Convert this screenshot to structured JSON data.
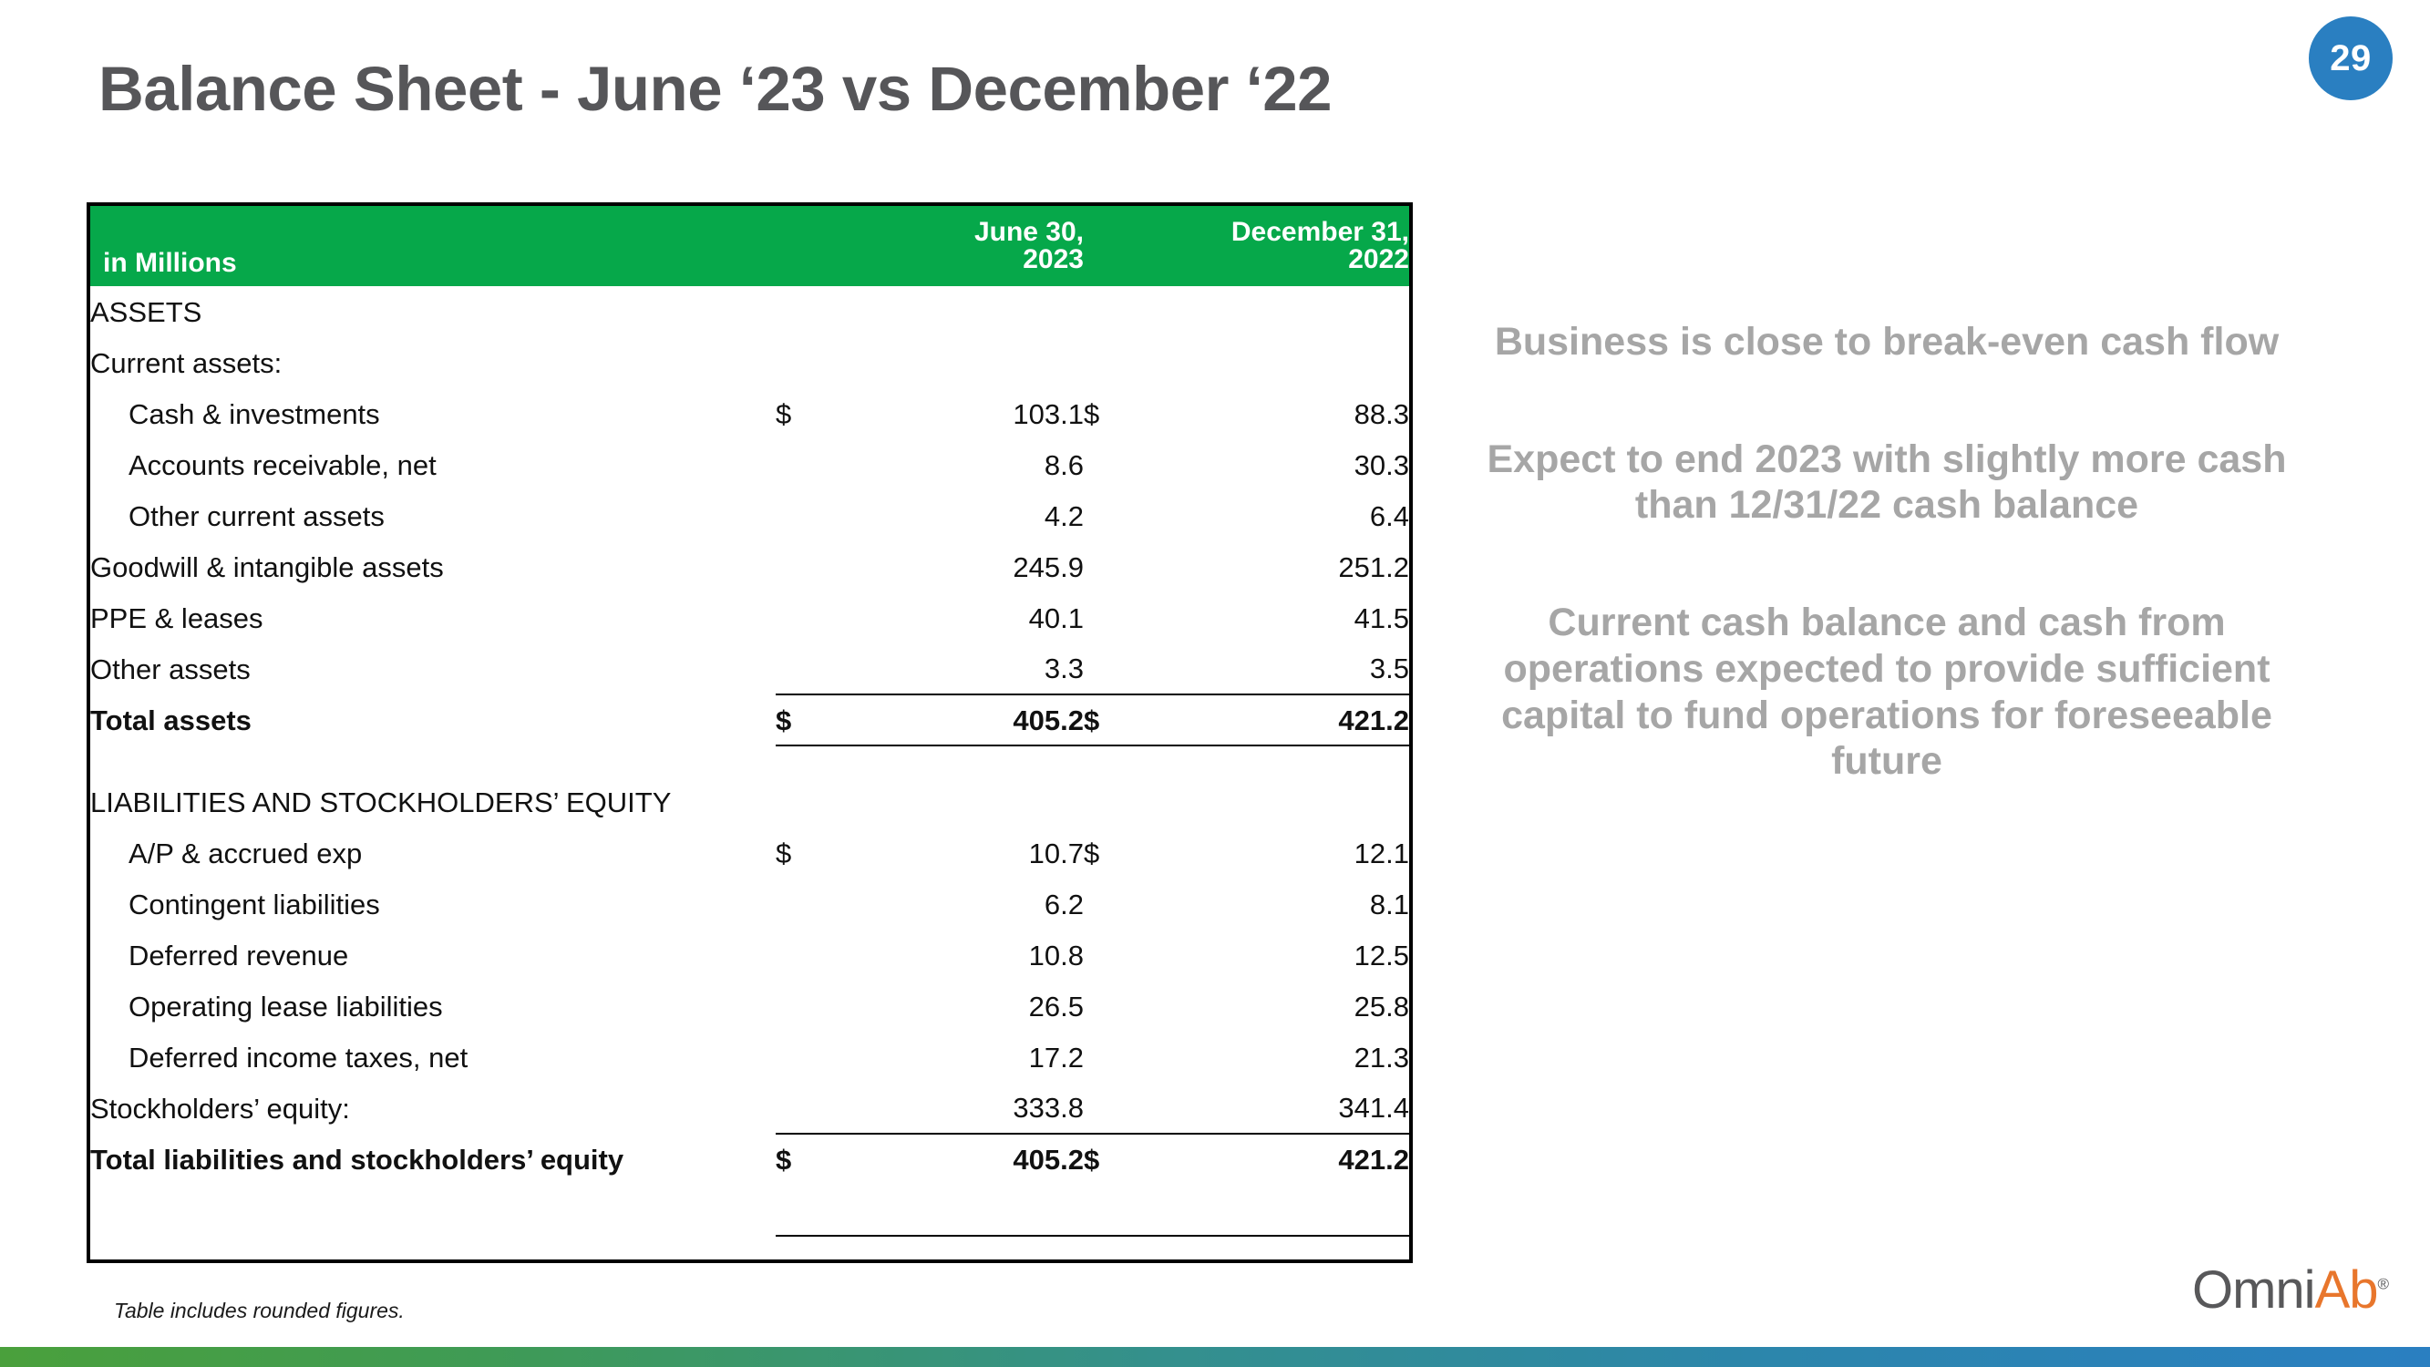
{
  "page_number": "29",
  "title": "Balance Sheet - June ‘23 vs December ‘22",
  "table": {
    "header": {
      "label_col": "in Millions",
      "col1_line1": "June 30,",
      "col1_line2": "2023",
      "col2_line1": "December 31,",
      "col2_line2": "2022"
    },
    "currency_symbol": "$",
    "rows": [
      {
        "label": "ASSETS",
        "indent": 0,
        "bold": false,
        "d1": "",
        "v1": "",
        "d2": "",
        "v2": ""
      },
      {
        "label": "Current assets:",
        "indent": 0,
        "bold": false,
        "d1": "",
        "v1": "",
        "d2": "",
        "v2": ""
      },
      {
        "label": "Cash & investments",
        "indent": 1,
        "bold": false,
        "d1": "$",
        "v1": "103.1",
        "d2": "$",
        "v2": "88.3"
      },
      {
        "label": "Accounts receivable, net",
        "indent": 1,
        "bold": false,
        "d1": "",
        "v1": "8.6",
        "d2": "",
        "v2": "30.3"
      },
      {
        "label": "Other current assets",
        "indent": 1,
        "bold": false,
        "d1": "",
        "v1": "4.2",
        "d2": "",
        "v2": "6.4"
      },
      {
        "label": "Goodwill & intangible assets",
        "indent": 0,
        "bold": false,
        "d1": "",
        "v1": "245.9",
        "d2": "",
        "v2": "251.2"
      },
      {
        "label": "PPE & leases",
        "indent": 0,
        "bold": false,
        "d1": "",
        "v1": "40.1",
        "d2": "",
        "v2": "41.5"
      },
      {
        "label": "Other assets",
        "indent": 0,
        "bold": false,
        "d1": "",
        "v1": "3.3",
        "d2": "",
        "v2": "3.5"
      },
      {
        "label": "Total assets",
        "indent": 0,
        "bold": true,
        "d1": "$",
        "v1": "405.2",
        "d2": "$",
        "v2": "421.2",
        "rule": "both"
      },
      {
        "label": "",
        "indent": 0,
        "bold": false,
        "d1": "",
        "v1": "",
        "d2": "",
        "v2": "",
        "gap": true
      },
      {
        "label": "LIABILITIES AND STOCKHOLDERS’ EQUITY",
        "indent": 0,
        "bold": false,
        "d1": "",
        "v1": "",
        "d2": "",
        "v2": ""
      },
      {
        "label": "A/P & accrued exp",
        "indent": 1,
        "bold": false,
        "d1": "$",
        "v1": "10.7",
        "d2": "$",
        "v2": "12.1"
      },
      {
        "label": "Contingent liabilities",
        "indent": 1,
        "bold": false,
        "d1": "",
        "v1": "6.2",
        "d2": "",
        "v2": "8.1"
      },
      {
        "label": "Deferred revenue",
        "indent": 1,
        "bold": false,
        "d1": "",
        "v1": "10.8",
        "d2": "",
        "v2": "12.5"
      },
      {
        "label": "Operating lease liabilities",
        "indent": 1,
        "bold": false,
        "d1": "",
        "v1": "26.5",
        "d2": "",
        "v2": "25.8"
      },
      {
        "label": "Deferred income taxes, net",
        "indent": 1,
        "bold": false,
        "d1": "",
        "v1": "17.2",
        "d2": "",
        "v2": "21.3"
      },
      {
        "label": "Stockholders’ equity:",
        "indent": 0,
        "bold": false,
        "d1": "",
        "v1": "333.8",
        "d2": "",
        "v2": "341.4"
      },
      {
        "label": "Total liabilities and stockholders’ equity",
        "indent": 0,
        "bold": true,
        "d1": "$",
        "v1": "405.2",
        "d2": "$",
        "v2": "421.2",
        "rule": "top"
      }
    ],
    "footnote": "Table includes rounded figures."
  },
  "commentary": [
    "Business is close to break-even cash flow",
    "Expect to end 2023 with slightly more cash than 12/31/22 cash balance",
    "Current cash balance and cash from operations expected to provide sufficient capital to fund operations for foreseeable future"
  ],
  "logo": {
    "part1": "Omni",
    "part2": "Ab",
    "registered": "®"
  },
  "colors": {
    "header_green": "#06a84a",
    "badge_blue": "#2a7fc1",
    "title_gray": "#565659",
    "commentary_gray": "#a6a6a6",
    "logo_orange": "#e8762c",
    "bar_start": "#4aa03c",
    "bar_end": "#2a7fc1"
  }
}
